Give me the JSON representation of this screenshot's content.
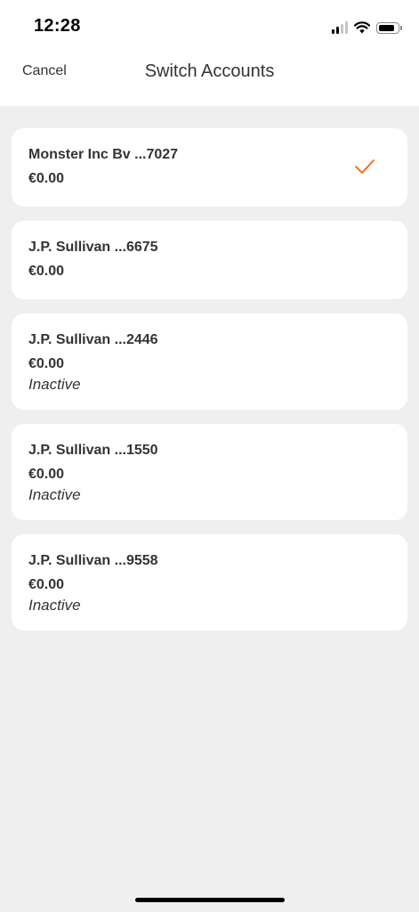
{
  "status_bar": {
    "time": "12:28"
  },
  "nav": {
    "cancel_label": "Cancel",
    "title": "Switch Accounts"
  },
  "accounts": [
    {
      "name": "Monster Inc Bv ...7027",
      "balance": "€0.00",
      "status": "",
      "selected": true
    },
    {
      "name": "J.P. Sullivan ...6675",
      "balance": "€0.00",
      "status": "",
      "selected": false
    },
    {
      "name": "J.P. Sullivan ...2446",
      "balance": "€0.00",
      "status": "Inactive",
      "selected": false
    },
    {
      "name": "J.P. Sullivan ...1550",
      "balance": "€0.00",
      "status": "Inactive",
      "selected": false
    },
    {
      "name": "J.P. Sullivan ...9558",
      "balance": "€0.00",
      "status": "Inactive",
      "selected": false
    }
  ],
  "colors": {
    "accent": "#ff6200",
    "background": "#efefef",
    "card": "#ffffff",
    "text": "#333333"
  },
  "icons": {
    "selected": "checkmark-icon",
    "wifi": "wifi-icon",
    "signal": "signal-icon",
    "battery": "battery-icon"
  }
}
